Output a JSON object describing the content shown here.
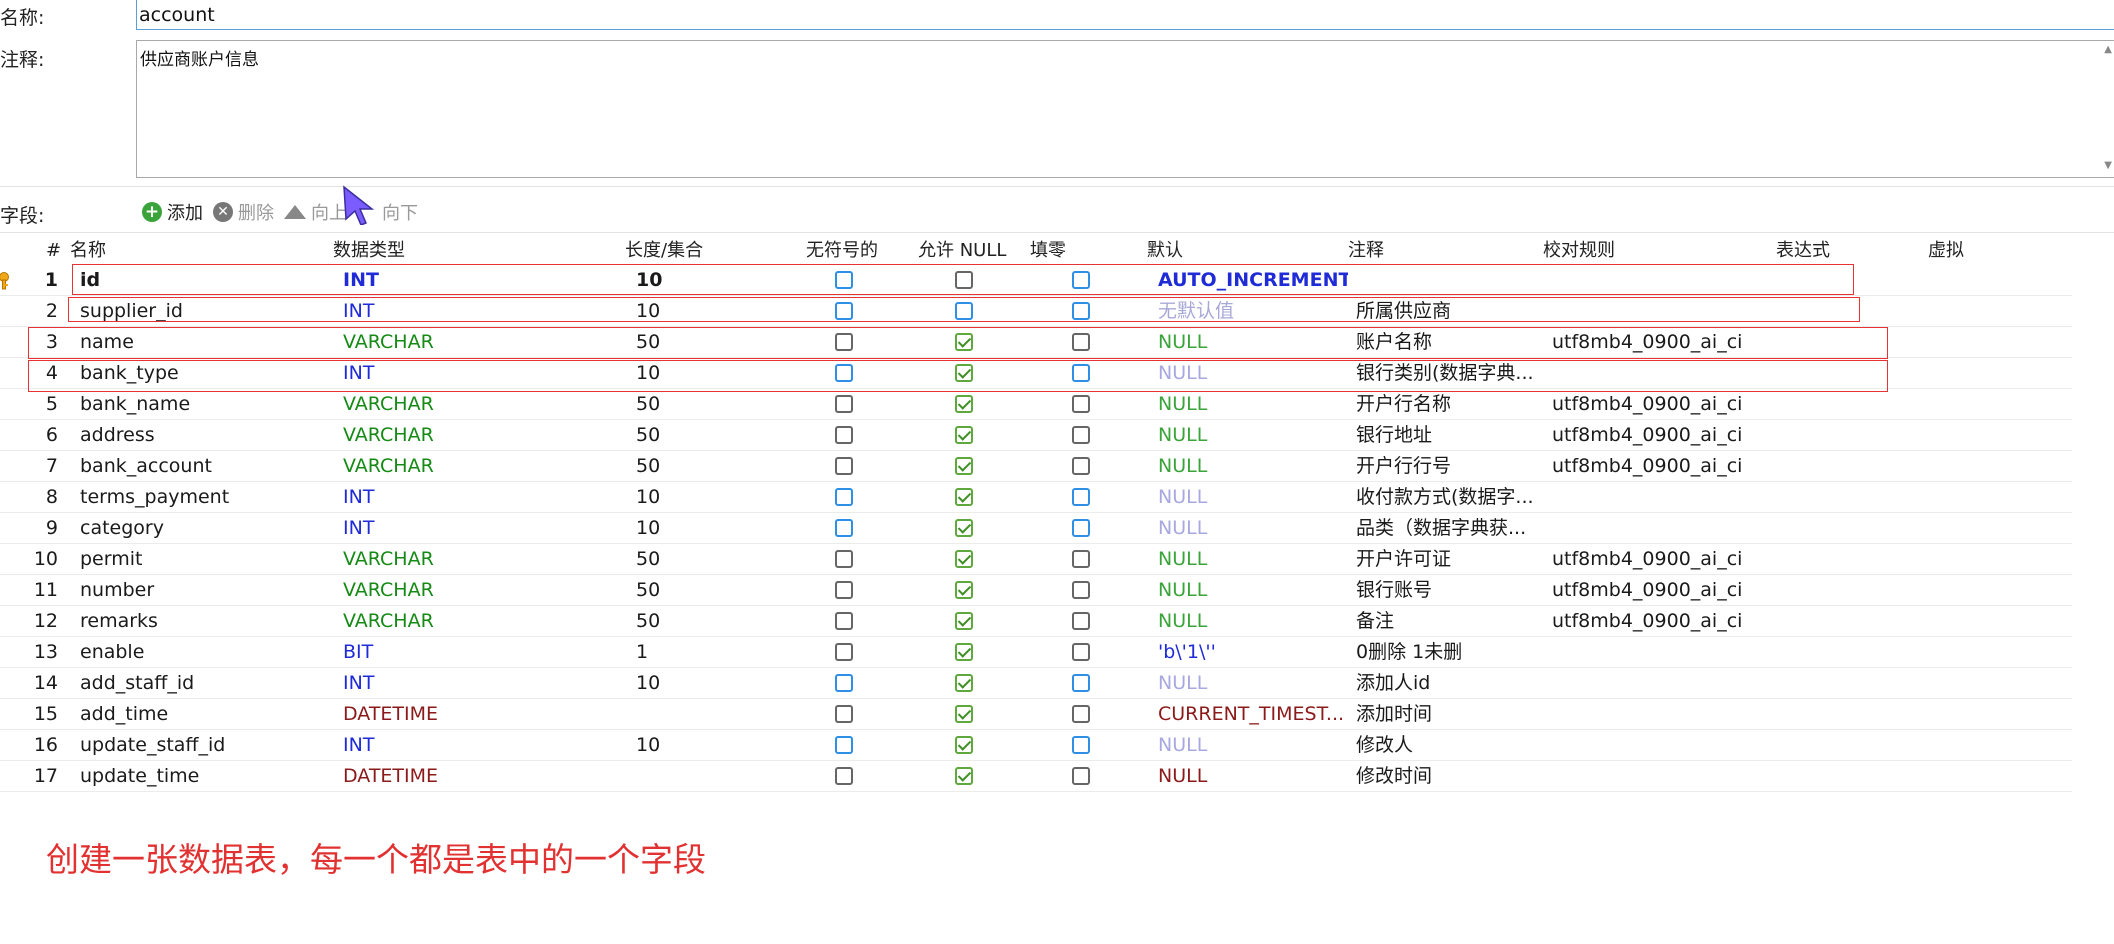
{
  "form": {
    "name_label": "名称:",
    "name_value": "account",
    "comment_label": "注释:",
    "comment_value": "供应商账户信息"
  },
  "toolbar": {
    "fields_label": "字段:",
    "add_label": "添加",
    "delete_label": "删除",
    "up_label": "向上",
    "down_label": "向下"
  },
  "grid": {
    "headers": {
      "index": "#",
      "name": "名称",
      "type": "数据类型",
      "length": "长度/集合",
      "unsigned": "无符号的",
      "nullable": "允许 NULL",
      "zerofill": "填零",
      "default": "默认",
      "comment": "注释",
      "collation": "校对规则",
      "expression": "表达式",
      "virtual": "虚拟"
    },
    "rows": [
      {
        "n": "1",
        "name": "id",
        "type": "INT",
        "length": "10",
        "unsigned": "unchecked-blue",
        "nullable": "unchecked",
        "zerofill": "unchecked-blue",
        "default": "AUTO_INCREMENT",
        "comment": "",
        "collation": "",
        "type_class": "int",
        "default_class": "auto",
        "bold": true
      },
      {
        "n": "2",
        "name": "supplier_id",
        "type": "INT",
        "length": "10",
        "unsigned": "unchecked-blue",
        "nullable": "unchecked-blue",
        "zerofill": "unchecked-blue",
        "default": "无默认值",
        "comment": "所属供应商",
        "collation": "",
        "type_class": "int",
        "default_class": "none"
      },
      {
        "n": "3",
        "name": "name",
        "type": "VARCHAR",
        "length": "50",
        "unsigned": "unchecked",
        "nullable": "checked",
        "zerofill": "unchecked",
        "default": "NULL",
        "comment": "账户名称",
        "collation": "utf8mb4_0900_ai_ci",
        "type_class": "varchar",
        "default_class": "null-green"
      },
      {
        "n": "4",
        "name": "bank_type",
        "type": "INT",
        "length": "10",
        "unsigned": "unchecked-blue",
        "nullable": "checked",
        "zerofill": "unchecked-blue",
        "default": "NULL",
        "comment": "银行类别(数据字典...",
        "collation": "",
        "type_class": "int",
        "default_class": "null-grey"
      },
      {
        "n": "5",
        "name": "bank_name",
        "type": "VARCHAR",
        "length": "50",
        "unsigned": "unchecked",
        "nullable": "checked",
        "zerofill": "unchecked",
        "default": "NULL",
        "comment": "开户行名称",
        "collation": "utf8mb4_0900_ai_ci",
        "type_class": "varchar",
        "default_class": "null-green"
      },
      {
        "n": "6",
        "name": "address",
        "type": "VARCHAR",
        "length": "50",
        "unsigned": "unchecked",
        "nullable": "checked",
        "zerofill": "unchecked",
        "default": "NULL",
        "comment": "银行地址",
        "collation": "utf8mb4_0900_ai_ci",
        "type_class": "varchar",
        "default_class": "null-green"
      },
      {
        "n": "7",
        "name": "bank_account",
        "type": "VARCHAR",
        "length": "50",
        "unsigned": "unchecked",
        "nullable": "checked",
        "zerofill": "unchecked",
        "default": "NULL",
        "comment": "开户行行号",
        "collation": "utf8mb4_0900_ai_ci",
        "type_class": "varchar",
        "default_class": "null-green"
      },
      {
        "n": "8",
        "name": "terms_payment",
        "type": "INT",
        "length": "10",
        "unsigned": "unchecked-blue",
        "nullable": "checked",
        "zerofill": "unchecked-blue",
        "default": "NULL",
        "comment": "收付款方式(数据字...",
        "collation": "",
        "type_class": "int",
        "default_class": "null-grey"
      },
      {
        "n": "9",
        "name": "category",
        "type": "INT",
        "length": "10",
        "unsigned": "unchecked-blue",
        "nullable": "checked",
        "zerofill": "unchecked-blue",
        "default": "NULL",
        "comment": "品类（数据字典获...",
        "collation": "",
        "type_class": "int",
        "default_class": "null-grey"
      },
      {
        "n": "10",
        "name": "permit",
        "type": "VARCHAR",
        "length": "50",
        "unsigned": "unchecked",
        "nullable": "checked",
        "zerofill": "unchecked",
        "default": "NULL",
        "comment": "开户许可证",
        "collation": "utf8mb4_0900_ai_ci",
        "type_class": "varchar",
        "default_class": "null-green"
      },
      {
        "n": "11",
        "name": "number",
        "type": "VARCHAR",
        "length": "50",
        "unsigned": "unchecked",
        "nullable": "checked",
        "zerofill": "unchecked",
        "default": "NULL",
        "comment": "银行账号",
        "collation": "utf8mb4_0900_ai_ci",
        "type_class": "varchar",
        "default_class": "null-green"
      },
      {
        "n": "12",
        "name": "remarks",
        "type": "VARCHAR",
        "length": "50",
        "unsigned": "unchecked",
        "nullable": "checked",
        "zerofill": "unchecked",
        "default": "NULL",
        "comment": "备注",
        "collation": "utf8mb4_0900_ai_ci",
        "type_class": "varchar",
        "default_class": "null-green"
      },
      {
        "n": "13",
        "name": "enable",
        "type": "BIT",
        "length": "1",
        "unsigned": "unchecked",
        "nullable": "checked",
        "zerofill": "unchecked",
        "default": "'b\\'1\\''",
        "comment": "0删除 1未删",
        "collation": "",
        "type_class": "int",
        "default_class": "bit"
      },
      {
        "n": "14",
        "name": "add_staff_id",
        "type": "INT",
        "length": "10",
        "unsigned": "unchecked-blue",
        "nullable": "checked",
        "zerofill": "unchecked-blue",
        "default": "NULL",
        "comment": "添加人id",
        "collation": "",
        "type_class": "int",
        "default_class": "null-grey"
      },
      {
        "n": "15",
        "name": "add_time",
        "type": "DATETIME",
        "length": "",
        "unsigned": "unchecked",
        "nullable": "checked",
        "zerofill": "unchecked",
        "default": "CURRENT_TIMEST...",
        "comment": "添加时间",
        "collation": "",
        "type_class": "datetime",
        "default_class": "datetime"
      },
      {
        "n": "16",
        "name": "update_staff_id",
        "type": "INT",
        "length": "10",
        "unsigned": "unchecked-blue",
        "nullable": "checked",
        "zerofill": "unchecked-blue",
        "default": "NULL",
        "comment": "修改人",
        "collation": "",
        "type_class": "int",
        "default_class": "null-grey"
      },
      {
        "n": "17",
        "name": "update_time",
        "type": "DATETIME",
        "length": "",
        "unsigned": "unchecked",
        "nullable": "checked",
        "zerofill": "unchecked",
        "default": "NULL",
        "comment": "修改时间",
        "collation": "",
        "type_class": "datetime",
        "default_class": "datetime"
      }
    ]
  },
  "annotation": {
    "caption": "创建一张数据表，每一个都是表中的一个字段"
  },
  "colors": {
    "int": "#1e2bd6",
    "varchar": "#158a15",
    "datetime": "#8b1a1a",
    "auto": "#1e2bd6",
    "null_green": "#3aa33a",
    "null_grey": "#a8a8e0",
    "none_default": "#a8a8d8",
    "highlight": "#e63333"
  }
}
